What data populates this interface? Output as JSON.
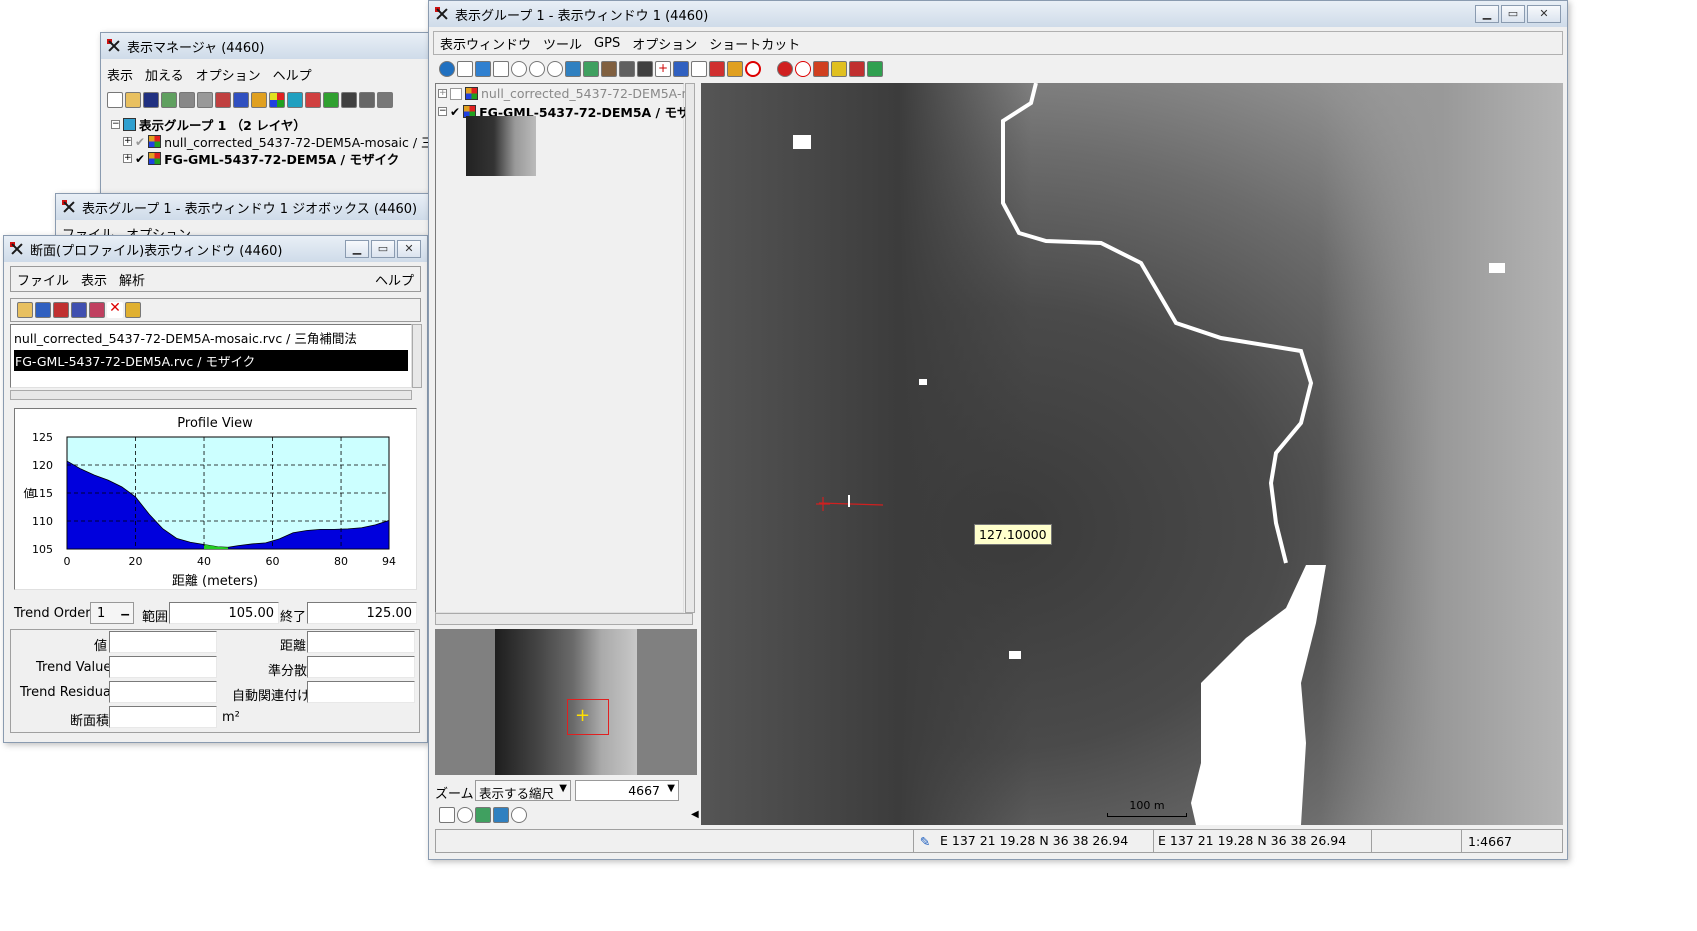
{
  "display_manager": {
    "title": "表示マネージャ (4460)",
    "menu": [
      "表示",
      "加える",
      "オプション",
      "ヘルプ"
    ],
    "group_label": "表示グループ 1 （2 レイヤ）",
    "layers": [
      "null_corrected_5437-72-DEM5A-mosaic / 三",
      "FG-GML-5437-72-DEM5A / モザイク"
    ]
  },
  "geobox_window": {
    "title": "表示グループ 1 - 表示ウィンドウ 1 ジオボックス (4460)",
    "menu": [
      "ファイル",
      "オプション"
    ]
  },
  "profile_window": {
    "title": "断面(プロファイル)表示ウィンドウ (4460)",
    "menu": [
      "ファイル",
      "表示",
      "解析"
    ],
    "help": "ヘルプ",
    "layers": [
      "null_corrected_5437-72-DEM5A-mosaic.rvc / 三角補間法",
      "FG-GML-5437-72-DEM5A.rvc / モザイク"
    ],
    "trend_order_label": "Trend Order",
    "trend_order_value": "1",
    "range_label": "範囲",
    "range_start": "105.00",
    "end_label": "終了",
    "range_end": "125.00",
    "fields": {
      "value": "値",
      "distance": "距離",
      "trend_value": "Trend Value",
      "variance": "準分散",
      "trend_residual": "Trend Residual",
      "autocorr": "自動関連付け",
      "area": "断面積",
      "area_unit": "m²"
    }
  },
  "chart_data": {
    "type": "area",
    "title": "Profile View",
    "xlabel": "距離 (meters)",
    "ylabel": "値",
    "xlim": [
      0,
      94
    ],
    "ylim": [
      105,
      125
    ],
    "x_ticks": [
      "0",
      "20",
      "40",
      "60",
      "80",
      "94"
    ],
    "y_ticks": [
      "125",
      "120",
      "115",
      "110",
      "105"
    ],
    "x": [
      0,
      4,
      8,
      12,
      16,
      20,
      24,
      28,
      32,
      36,
      40,
      44,
      47,
      50,
      54,
      58,
      62,
      66,
      70,
      74,
      78,
      82,
      86,
      90,
      94
    ],
    "y": [
      120.7,
      119.3,
      118.2,
      117.3,
      116.1,
      114.3,
      111.2,
      108.6,
      106.9,
      106.2,
      105.8,
      105.4,
      105.3,
      105.6,
      105.9,
      106.1,
      106.8,
      107.9,
      108.3,
      108.5,
      108.5,
      108.6,
      108.8,
      109.3,
      110.1
    ],
    "highlight_range": [
      40,
      47
    ],
    "colors": {
      "fill": "#0000dd",
      "highlight": "#22cc22",
      "background": "#ccffff"
    },
    "grid": true
  },
  "view_window": {
    "title": "表示グループ 1 - 表示ウィンドウ 1 (4460)",
    "menu": [
      "表示ウィンドウ",
      "ツール",
      "GPS",
      "オプション",
      "ショートカット"
    ],
    "layers": [
      "null_corrected_5437-72-DEM5A-m",
      "FG-GML-5437-72-DEM5A / モザ"
    ],
    "zoom_label": "ズーム",
    "zoom_select": "表示する縮尺",
    "zoom_value": "4667",
    "tooltip": "127.10000",
    "scalebar": "100 m",
    "status_coord_1": "E 137 21 19.28  N 36 38 26.94",
    "status_coord_2": "E 137 21 19.28  N 36 38 26.94",
    "status_scale": "1:4667"
  }
}
